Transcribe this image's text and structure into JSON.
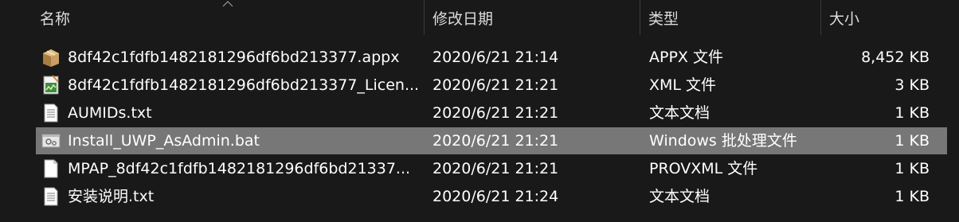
{
  "columns": {
    "name": "名称",
    "date": "修改日期",
    "type": "类型",
    "size": "大小"
  },
  "files": [
    {
      "name": "8df42c1fdfb1482181296df6bd213377.appx",
      "date": "2020/6/21 21:14",
      "type": "APPX 文件",
      "size": "8,452 KB",
      "icon": "package-icon",
      "selected": false
    },
    {
      "name": "8df42c1fdfb1482181296df6bd213377_Licen...",
      "date": "2020/6/21 21:21",
      "type": "XML 文件",
      "size": "3 KB",
      "icon": "xml-file-icon",
      "selected": false
    },
    {
      "name": "AUMIDs.txt",
      "date": "2020/6/21 21:21",
      "type": "文本文档",
      "size": "1 KB",
      "icon": "text-file-icon",
      "selected": false
    },
    {
      "name": "Install_UWP_AsAdmin.bat",
      "date": "2020/6/21 21:21",
      "type": "Windows 批处理文件",
      "size": "1 KB",
      "icon": "batch-file-icon",
      "selected": true
    },
    {
      "name": "MPAP_8df42c1fdfb1482181296df6bd21337...",
      "date": "2020/6/21 21:21",
      "type": "PROVXML 文件",
      "size": "1 KB",
      "icon": "blank-file-icon",
      "selected": false
    },
    {
      "name": "安装说明.txt",
      "date": "2020/6/21 21:24",
      "type": "文本文档",
      "size": "1 KB",
      "icon": "text-file-icon",
      "selected": false
    }
  ],
  "colors": {
    "background": "#191919",
    "selected_row": "#777777",
    "header_text": "#dcdcdc"
  }
}
